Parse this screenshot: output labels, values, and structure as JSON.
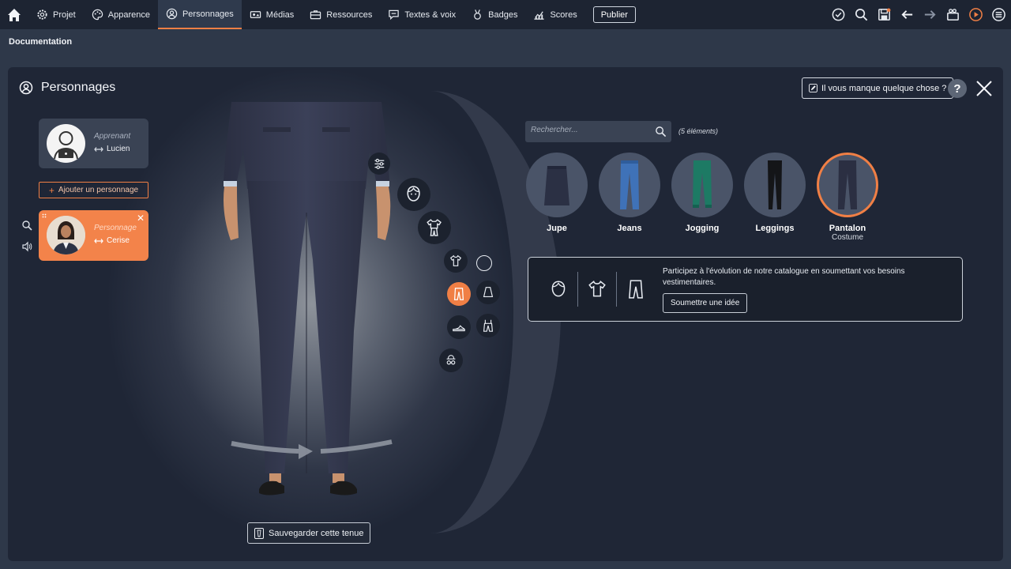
{
  "nav": {
    "items": [
      {
        "label": "Projet",
        "icon": "gear-icon"
      },
      {
        "label": "Apparence",
        "icon": "palette-icon"
      },
      {
        "label": "Personnages",
        "icon": "person-circle-icon",
        "active": true
      },
      {
        "label": "Médias",
        "icon": "media-icon"
      },
      {
        "label": "Ressources",
        "icon": "briefcase-icon"
      },
      {
        "label": "Textes & voix",
        "icon": "speech-icon"
      },
      {
        "label": "Badges",
        "icon": "badge-icon"
      },
      {
        "label": "Scores",
        "icon": "chart-icon"
      }
    ],
    "publish_label": "Publier"
  },
  "breadcrumb": "Documentation",
  "panel": {
    "title": "Personnages",
    "missing_label": "Il vous manque quelque chose ?",
    "help_label": "?"
  },
  "characters": {
    "add_label": "Ajouter un personnage",
    "list": [
      {
        "role": "Apprenant",
        "name": "Lucien"
      },
      {
        "role": "Personnage",
        "name": "Cerise",
        "active": true
      }
    ]
  },
  "catalog": {
    "search_placeholder": "Rechercher...",
    "count": "(5 éléments)",
    "items": [
      {
        "name": "Jupe",
        "sub": ""
      },
      {
        "name": "Jeans",
        "sub": ""
      },
      {
        "name": "Jogging",
        "sub": ""
      },
      {
        "name": "Leggings",
        "sub": ""
      },
      {
        "name": "Pantalon",
        "sub": "Costume",
        "selected": true
      }
    ]
  },
  "idea": {
    "text": "Participez à l'évolution de notre catalogue en soumettant vos besoins vestimentaires.",
    "button": "Soumettre une idée"
  },
  "save_outfit_label": "Sauvegarder cette tenue",
  "colors": {
    "accent": "#f07f45",
    "background": "#2e3849",
    "topbar": "#1d2432"
  }
}
